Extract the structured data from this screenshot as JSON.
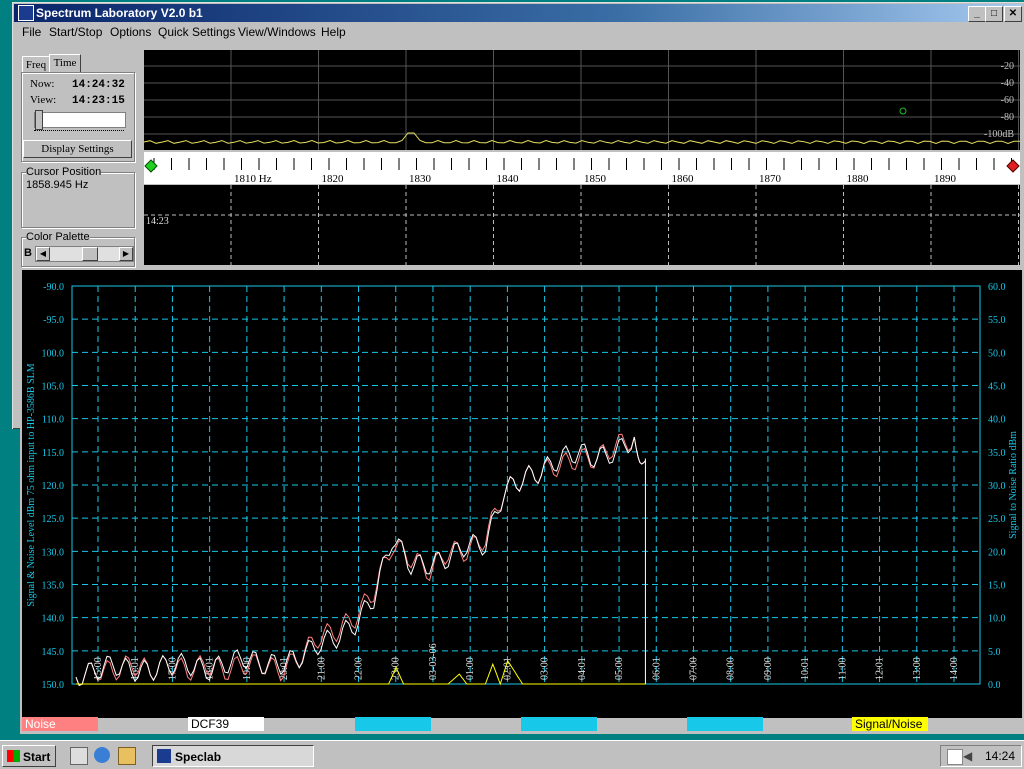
{
  "app": {
    "title": "Spectrum Laboratory V2.0 b1"
  },
  "window_buttons": {
    "min": "_",
    "max": "□",
    "close": "✕"
  },
  "menu": [
    "File",
    "Start/Stop",
    "Options",
    "Quick Settings",
    "View/Windows",
    "Help"
  ],
  "left_panel": {
    "tabs": [
      "Freq",
      "Time"
    ],
    "now_label": "Now:",
    "now_value": "14:24:32",
    "view_label": "View:",
    "view_value": "14:23:15",
    "display_settings": "Display Settings",
    "cursor_title": "Cursor Position",
    "cursor_value": "1858.945 Hz",
    "palette_title": "Color Palette",
    "palette_b": "B"
  },
  "spectrum": {
    "db_labels": [
      "-20",
      "-40",
      "-60",
      "-80",
      "-100dB"
    ],
    "freq_labels": [
      "1810 Hz",
      "1820",
      "1830",
      "1840",
      "1850",
      "1860",
      "1870",
      "1880",
      "1890"
    ],
    "waterfall_time": "14:23"
  },
  "chart_data": {
    "type": "line",
    "ylabel_left": "Signal & Noise Level dBm 75 ohm input to HP-3586B SLM",
    "ylabel_right": "Signal to Noise Ratio dBm",
    "left_ticks": [
      "-90.0",
      "-95.0",
      "100.0",
      "105.0",
      "110.0",
      "115.0",
      "120.0",
      "125.0",
      "130.0",
      "135.0",
      "140.0",
      "145.0",
      "150.0"
    ],
    "right_ticks": [
      "60.0",
      "55.0",
      "50.0",
      "45.0",
      "40.0",
      "35.0",
      "30.0",
      "25.0",
      "20.0",
      "15.0",
      "10.0",
      "5.0",
      "0.0"
    ],
    "ylim_left": [
      -150,
      -90
    ],
    "ylim_right": [
      0,
      60
    ],
    "x_ticks": [
      "15:00",
      "16:01",
      "17:00",
      "18:01",
      "19:00",
      "20:01",
      "21:00",
      "22:00",
      "23:00",
      "03-03-06",
      "01:00",
      "02:01",
      "03:00",
      "04:01",
      "05:00",
      "06:01",
      "07:00",
      "08:00",
      "09:00",
      "10:01",
      "11:00",
      "12:01",
      "13:00",
      "14:00"
    ],
    "grid": true,
    "series": [
      {
        "name": "Noise",
        "color": "#ff8080",
        "points_hours": [
          0,
          0.5,
          1,
          1.5,
          2,
          2.5,
          3,
          3.5,
          4,
          4.5,
          5,
          5.5,
          6,
          6.5,
          7,
          7.5,
          8,
          8.5,
          9,
          9.5,
          10,
          10.5,
          11,
          11.5,
          12,
          12.5,
          13,
          13.5,
          14,
          14.5,
          15,
          15.3
        ],
        "values": [
          -149,
          -148,
          -148,
          -147,
          -148,
          -147,
          -148,
          -147,
          -148,
          -147,
          -147,
          -148,
          -146,
          -143,
          -142,
          -140,
          -136,
          -129,
          -131,
          -133,
          -130,
          -130,
          -128,
          -121,
          -119,
          -118,
          -117,
          -116,
          -116,
          -114,
          -113,
          -117
        ]
      },
      {
        "name": "DCF39",
        "color": "#ffffff",
        "points_hours": [
          0,
          0.5,
          1,
          1.5,
          2,
          2.5,
          3,
          3.5,
          4,
          4.5,
          5,
          5.5,
          6,
          6.5,
          7,
          7.5,
          8,
          8.5,
          9,
          9.5,
          10,
          10.5,
          11,
          11.5,
          12,
          12.5,
          13,
          13.5,
          14,
          14.5,
          15,
          15.3
        ],
        "values": [
          -149,
          -148,
          -147,
          -148,
          -148,
          -147,
          -147,
          -148,
          -147,
          -146,
          -147,
          -147,
          -146,
          -144,
          -143,
          -141,
          -137,
          -128,
          -132,
          -132,
          -131,
          -129,
          -129,
          -121,
          -119,
          -118,
          -116,
          -115,
          -116,
          -115,
          -113,
          -117
        ]
      },
      {
        "name": "Signal/Noise",
        "color": "#ffff00",
        "points_hours": [
          0,
          8.4,
          8.6,
          8.8,
          9,
          10,
          10.3,
          10.5,
          11,
          11.2,
          11.4,
          11.6,
          12,
          15.3
        ],
        "values": [
          0,
          0,
          2.5,
          0,
          0,
          0,
          1.5,
          0,
          0,
          3.0,
          0,
          3.5,
          0,
          0
        ]
      }
    ]
  },
  "legend": [
    {
      "label": "Noise",
      "color": "#ff8080"
    },
    {
      "label": "DCF39",
      "color": "#ffffff"
    },
    {
      "label": "",
      "color": "#18c8e8"
    },
    {
      "label": "",
      "color": "#18c8e8"
    },
    {
      "label": "",
      "color": "#18c8e8"
    },
    {
      "label": "Signal/Noise",
      "color": "#ffff00"
    }
  ],
  "taskbar": {
    "start": "Start",
    "task": "Speclab",
    "clock": "14:24"
  }
}
